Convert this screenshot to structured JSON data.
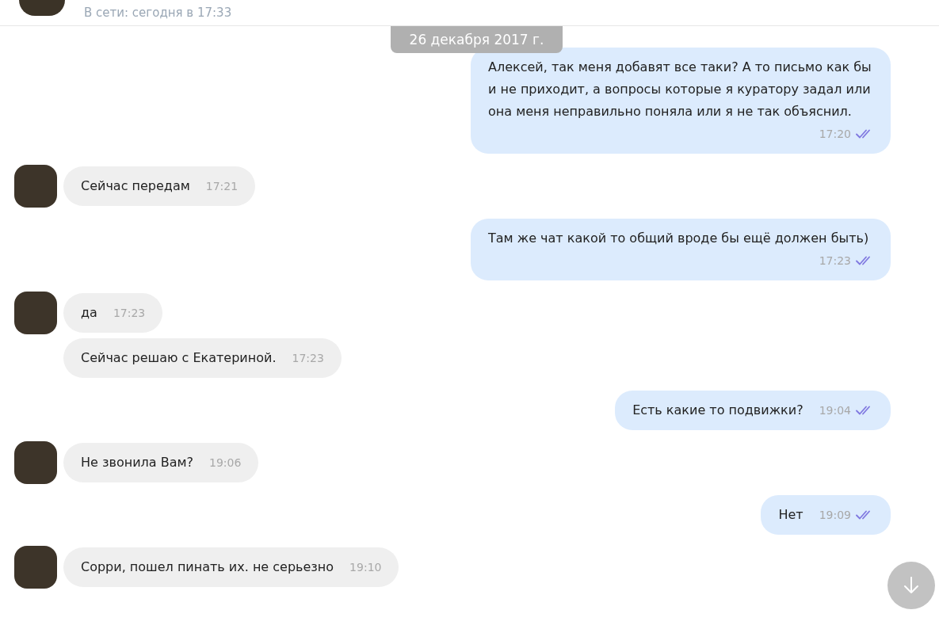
{
  "header": {
    "status": "В сети: сегодня в 17:33"
  },
  "date_badge": "26 декабря 2017 г.",
  "messages": [
    {
      "kind": "outgoing",
      "text": "Алексей, так меня добавят все таки? А то письмо как бы и не приходит, а вопросы которые я куратору задал или она меня неправильно поняла или я не так объяснил.",
      "time": "17:20",
      "read": true
    },
    {
      "kind": "incoming",
      "text": "Сейчас передам",
      "time": "17:21",
      "show_avatar": true
    },
    {
      "kind": "outgoing",
      "text": "Там же чат какой то общий вроде бы ещё должен быть)",
      "time": "17:23",
      "read": true
    },
    {
      "kind": "incoming",
      "text": "да",
      "time": "17:23",
      "show_avatar": true
    },
    {
      "kind": "incoming",
      "text": "Сейчас решаю с Екатериной.",
      "time": "17:23",
      "show_avatar": false
    },
    {
      "kind": "outgoing",
      "text": "Есть какие то подвижки?",
      "time": "19:04",
      "read": true
    },
    {
      "kind": "incoming",
      "text": "Не звонила Вам?",
      "time": "19:06",
      "show_avatar": true
    },
    {
      "kind": "outgoing",
      "text": "Нет",
      "time": "19:09",
      "read": true
    },
    {
      "kind": "incoming",
      "text": "Сорри, пошел пинать их. не серьезно",
      "time": "19:10",
      "show_avatar": true
    }
  ]
}
